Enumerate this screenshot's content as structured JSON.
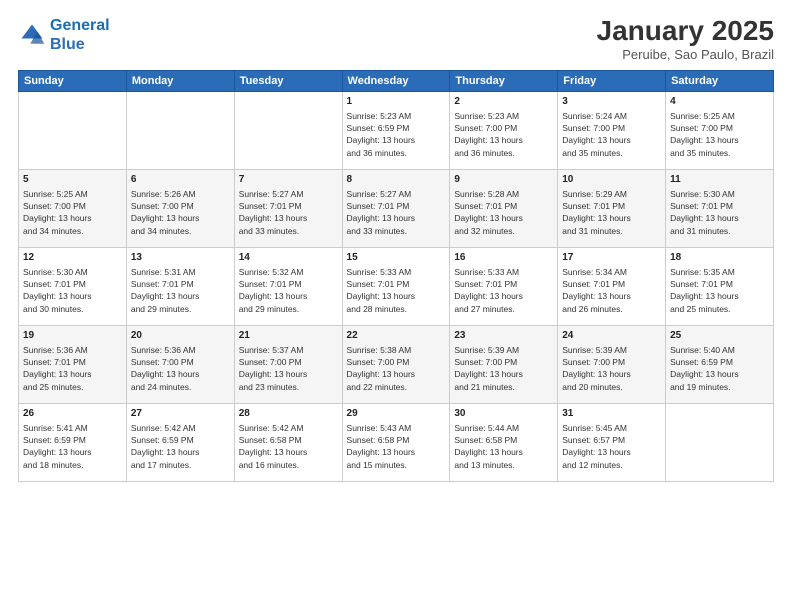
{
  "header": {
    "logo_line1": "General",
    "logo_line2": "Blue",
    "title": "January 2025",
    "subtitle": "Peruibe, Sao Paulo, Brazil"
  },
  "weekdays": [
    "Sunday",
    "Monday",
    "Tuesday",
    "Wednesday",
    "Thursday",
    "Friday",
    "Saturday"
  ],
  "weeks": [
    [
      {
        "day": "",
        "content": ""
      },
      {
        "day": "",
        "content": ""
      },
      {
        "day": "",
        "content": ""
      },
      {
        "day": "1",
        "content": "Sunrise: 5:23 AM\nSunset: 6:59 PM\nDaylight: 13 hours\nand 36 minutes."
      },
      {
        "day": "2",
        "content": "Sunrise: 5:23 AM\nSunset: 7:00 PM\nDaylight: 13 hours\nand 36 minutes."
      },
      {
        "day": "3",
        "content": "Sunrise: 5:24 AM\nSunset: 7:00 PM\nDaylight: 13 hours\nand 35 minutes."
      },
      {
        "day": "4",
        "content": "Sunrise: 5:25 AM\nSunset: 7:00 PM\nDaylight: 13 hours\nand 35 minutes."
      }
    ],
    [
      {
        "day": "5",
        "content": "Sunrise: 5:25 AM\nSunset: 7:00 PM\nDaylight: 13 hours\nand 34 minutes."
      },
      {
        "day": "6",
        "content": "Sunrise: 5:26 AM\nSunset: 7:00 PM\nDaylight: 13 hours\nand 34 minutes."
      },
      {
        "day": "7",
        "content": "Sunrise: 5:27 AM\nSunset: 7:01 PM\nDaylight: 13 hours\nand 33 minutes."
      },
      {
        "day": "8",
        "content": "Sunrise: 5:27 AM\nSunset: 7:01 PM\nDaylight: 13 hours\nand 33 minutes."
      },
      {
        "day": "9",
        "content": "Sunrise: 5:28 AM\nSunset: 7:01 PM\nDaylight: 13 hours\nand 32 minutes."
      },
      {
        "day": "10",
        "content": "Sunrise: 5:29 AM\nSunset: 7:01 PM\nDaylight: 13 hours\nand 31 minutes."
      },
      {
        "day": "11",
        "content": "Sunrise: 5:30 AM\nSunset: 7:01 PM\nDaylight: 13 hours\nand 31 minutes."
      }
    ],
    [
      {
        "day": "12",
        "content": "Sunrise: 5:30 AM\nSunset: 7:01 PM\nDaylight: 13 hours\nand 30 minutes."
      },
      {
        "day": "13",
        "content": "Sunrise: 5:31 AM\nSunset: 7:01 PM\nDaylight: 13 hours\nand 29 minutes."
      },
      {
        "day": "14",
        "content": "Sunrise: 5:32 AM\nSunset: 7:01 PM\nDaylight: 13 hours\nand 29 minutes."
      },
      {
        "day": "15",
        "content": "Sunrise: 5:33 AM\nSunset: 7:01 PM\nDaylight: 13 hours\nand 28 minutes."
      },
      {
        "day": "16",
        "content": "Sunrise: 5:33 AM\nSunset: 7:01 PM\nDaylight: 13 hours\nand 27 minutes."
      },
      {
        "day": "17",
        "content": "Sunrise: 5:34 AM\nSunset: 7:01 PM\nDaylight: 13 hours\nand 26 minutes."
      },
      {
        "day": "18",
        "content": "Sunrise: 5:35 AM\nSunset: 7:01 PM\nDaylight: 13 hours\nand 25 minutes."
      }
    ],
    [
      {
        "day": "19",
        "content": "Sunrise: 5:36 AM\nSunset: 7:01 PM\nDaylight: 13 hours\nand 25 minutes."
      },
      {
        "day": "20",
        "content": "Sunrise: 5:36 AM\nSunset: 7:00 PM\nDaylight: 13 hours\nand 24 minutes."
      },
      {
        "day": "21",
        "content": "Sunrise: 5:37 AM\nSunset: 7:00 PM\nDaylight: 13 hours\nand 23 minutes."
      },
      {
        "day": "22",
        "content": "Sunrise: 5:38 AM\nSunset: 7:00 PM\nDaylight: 13 hours\nand 22 minutes."
      },
      {
        "day": "23",
        "content": "Sunrise: 5:39 AM\nSunset: 7:00 PM\nDaylight: 13 hours\nand 21 minutes."
      },
      {
        "day": "24",
        "content": "Sunrise: 5:39 AM\nSunset: 7:00 PM\nDaylight: 13 hours\nand 20 minutes."
      },
      {
        "day": "25",
        "content": "Sunrise: 5:40 AM\nSunset: 6:59 PM\nDaylight: 13 hours\nand 19 minutes."
      }
    ],
    [
      {
        "day": "26",
        "content": "Sunrise: 5:41 AM\nSunset: 6:59 PM\nDaylight: 13 hours\nand 18 minutes."
      },
      {
        "day": "27",
        "content": "Sunrise: 5:42 AM\nSunset: 6:59 PM\nDaylight: 13 hours\nand 17 minutes."
      },
      {
        "day": "28",
        "content": "Sunrise: 5:42 AM\nSunset: 6:58 PM\nDaylight: 13 hours\nand 16 minutes."
      },
      {
        "day": "29",
        "content": "Sunrise: 5:43 AM\nSunset: 6:58 PM\nDaylight: 13 hours\nand 15 minutes."
      },
      {
        "day": "30",
        "content": "Sunrise: 5:44 AM\nSunset: 6:58 PM\nDaylight: 13 hours\nand 13 minutes."
      },
      {
        "day": "31",
        "content": "Sunrise: 5:45 AM\nSunset: 6:57 PM\nDaylight: 13 hours\nand 12 minutes."
      },
      {
        "day": "",
        "content": ""
      }
    ]
  ]
}
